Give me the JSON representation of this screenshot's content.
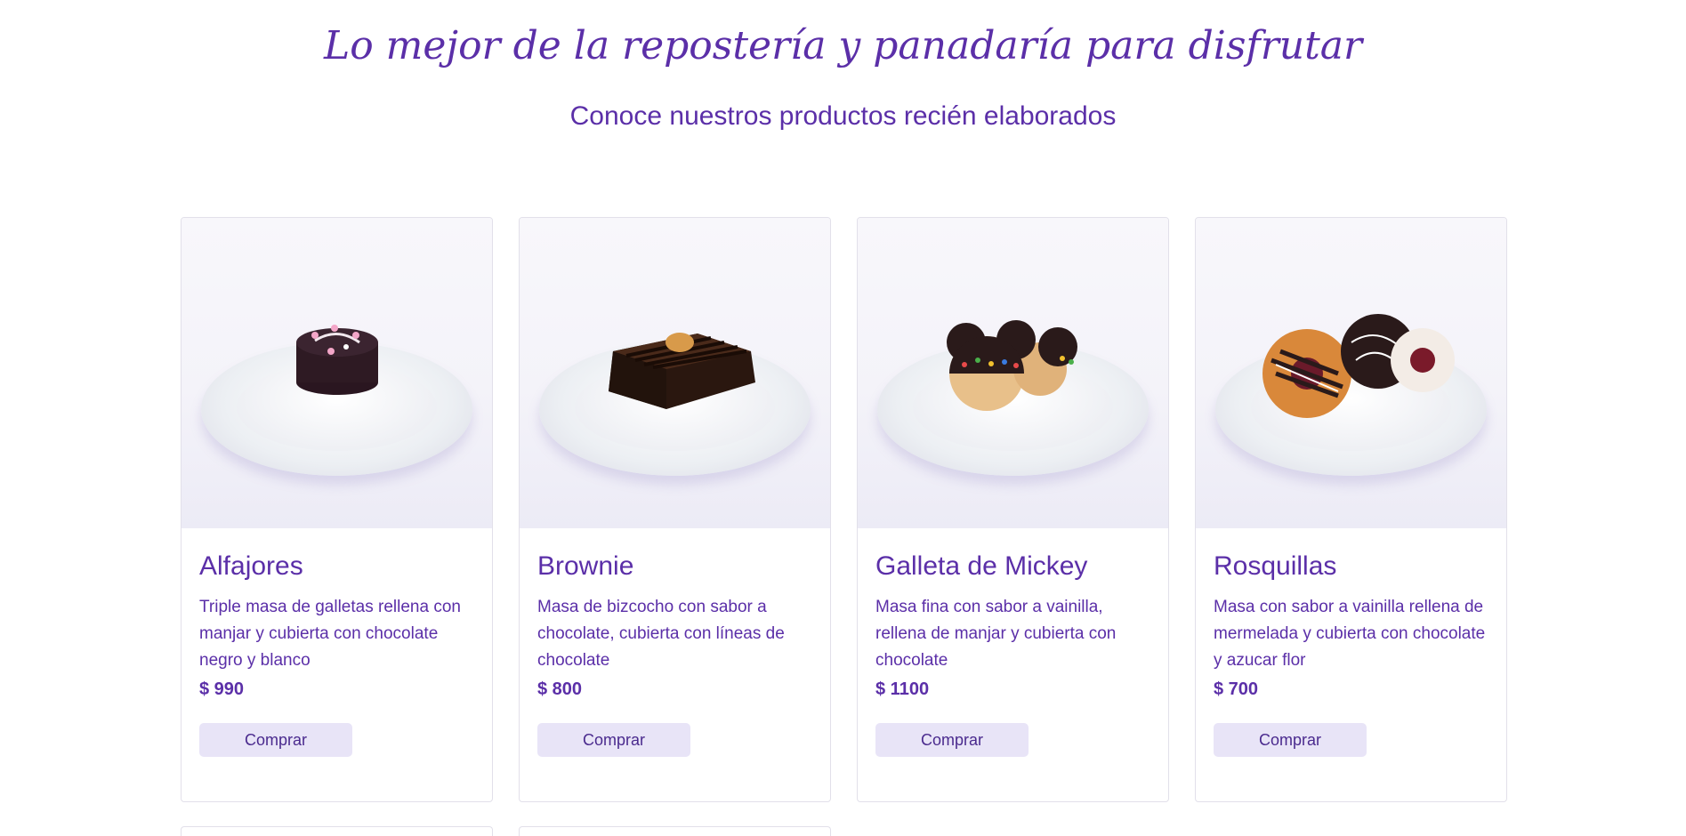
{
  "hero": {
    "title": "Lo mejor de la repostería y panadaría para disfrutar",
    "subtitle": "Conoce nuestros productos recién elaborados"
  },
  "products": [
    {
      "name": "Alfajores",
      "description": "Triple masa de galletas rellena con manjar y cubierta con chocolate negro y blanco",
      "price": "$ 990",
      "button": "Comprar",
      "image_icon": "alfajor-photo"
    },
    {
      "name": "Brownie",
      "description": "Masa de bizcocho con sabor a chocolate, cubierta con líneas de chocolate",
      "price": "$ 800",
      "button": "Comprar",
      "image_icon": "brownie-photo"
    },
    {
      "name": "Galleta de Mickey",
      "description": "Masa fina con sabor a vainilla, rellena de manjar y cubierta con chocolate",
      "price": "$ 1100",
      "button": "Comprar",
      "image_icon": "mickey-cookie-photo"
    },
    {
      "name": "Rosquillas",
      "description": "Masa con sabor a vainilla rellena de mermelada y cubierta con chocolate y azucar flor",
      "price": "$ 700",
      "button": "Comprar",
      "image_icon": "rosquillas-photo"
    }
  ],
  "colors": {
    "accent": "#5b2fa8",
    "button_bg": "#e8e4f7",
    "card_border": "#e2e0ea"
  }
}
